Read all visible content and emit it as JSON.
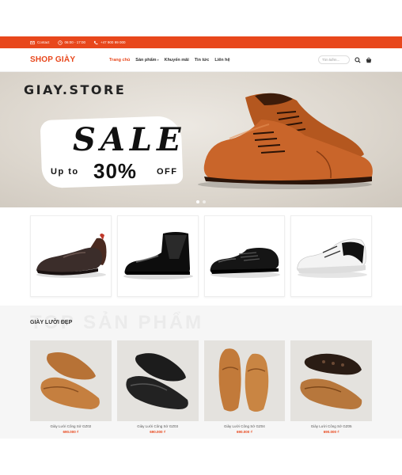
{
  "topbar": {
    "contact": "Contact",
    "hours": "06:00 - 17:00",
    "phone": "+47 900 99 000",
    "bg": "#e8471c"
  },
  "header": {
    "logo": "SHOP GIÀY",
    "nav": [
      "Trang chủ",
      "Sản phẩm",
      "Khuyến mãi",
      "Tin tức",
      "Liên hệ"
    ],
    "search_placeholder": "Tìm kiếm...",
    "accent": "#e8471c"
  },
  "banner": {
    "brand": "GIAY.STORE",
    "sale": "SALE",
    "upto": "Up to",
    "percent": "30%",
    "off": "OFF",
    "slides": 2,
    "active_slide": 1
  },
  "categories": [
    {
      "icon": "loafer-shoe"
    },
    {
      "icon": "chelsea-boot"
    },
    {
      "icon": "oxford-shoe"
    },
    {
      "icon": "sneaker"
    }
  ],
  "products_section": {
    "watermark": "TOP SẢN PHẨM",
    "title": "GIÀY LƯỜI ĐẸP",
    "items": [
      {
        "name": "Giày Lười Công Sở GZ02",
        "price": "690.000 ₫"
      },
      {
        "name": "Giày Lười Công Sở GZ03",
        "price": "690.000 ₫"
      },
      {
        "name": "Giày Lười Công Sở GZ04",
        "price": "690.000 ₫"
      },
      {
        "name": "Giày Lười Công Sở GZ05",
        "price": "690.000 ₫"
      }
    ]
  }
}
